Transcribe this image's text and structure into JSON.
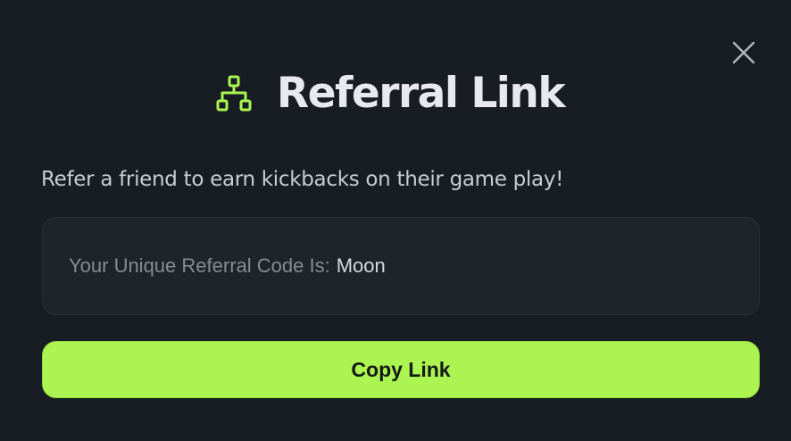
{
  "modal": {
    "title": "Referral Link",
    "subtitle": "Refer a friend to earn kickbacks on their game play!",
    "code_label": "Your Unique Referral Code Is:",
    "code_value": "Moon",
    "copy_button_label": "Copy Link",
    "title_icon": "network-tree-icon",
    "close_icon": "close-icon"
  },
  "colors": {
    "background": "#181c23",
    "accent": "#abf451",
    "code_box": "#1f242b"
  }
}
